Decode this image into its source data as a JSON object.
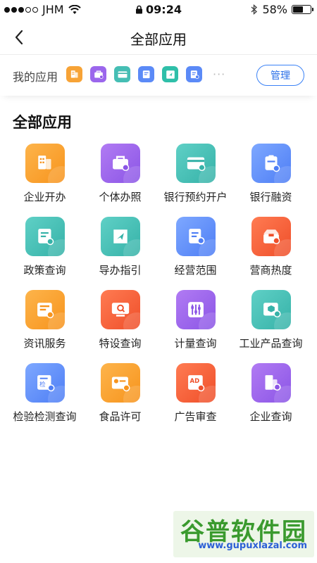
{
  "status_bar": {
    "carrier": "JHM",
    "time": "09:24",
    "battery": "58%",
    "battery_level": 0.58
  },
  "nav": {
    "title": "全部应用"
  },
  "my_apps": {
    "label": "我的应用",
    "icons": [
      {
        "icon": "building-icon",
        "color": "#f7a336"
      },
      {
        "icon": "briefcase-icon",
        "color": "#9b66ec"
      },
      {
        "icon": "card-icon",
        "color": "#45beb4"
      },
      {
        "icon": "document-icon",
        "color": "#5b8af7"
      },
      {
        "icon": "guide-icon",
        "color": "#2fbfa9"
      },
      {
        "icon": "document-search-icon",
        "color": "#5b8af7"
      }
    ],
    "more": "···",
    "manage_label": "管理"
  },
  "all_apps": {
    "title": "全部应用",
    "items": [
      {
        "label": "企业开办",
        "icon": "building-icon",
        "color": "orange"
      },
      {
        "label": "个体办照",
        "icon": "briefcase-icon",
        "color": "purple"
      },
      {
        "label": "银行预约开户",
        "icon": "bank-card-icon",
        "color": "teal"
      },
      {
        "label": "银行融资",
        "icon": "clipboard-yen-icon",
        "color": "blue"
      },
      {
        "label": "政策查询",
        "icon": "certificate-icon",
        "color": "teal"
      },
      {
        "label": "导办指引",
        "icon": "guide-book-icon",
        "color": "teal"
      },
      {
        "label": "经营范围",
        "icon": "document-search-icon",
        "color": "blue"
      },
      {
        "label": "营商热度",
        "icon": "box-fire-icon",
        "color": "red"
      },
      {
        "label": "资讯服务",
        "icon": "news-icon",
        "color": "orange"
      },
      {
        "label": "特设查询",
        "icon": "monitor-search-icon",
        "color": "red"
      },
      {
        "label": "计量查询",
        "icon": "sliders-icon",
        "color": "purple"
      },
      {
        "label": "工业产品查询",
        "icon": "product-search-icon",
        "color": "teal"
      },
      {
        "label": "检验检测查询",
        "icon": "inspection-icon",
        "color": "blue"
      },
      {
        "label": "食品许可",
        "icon": "food-license-icon",
        "color": "orange"
      },
      {
        "label": "广告审查",
        "icon": "ad-review-icon",
        "color": "red"
      },
      {
        "label": "企业查询",
        "icon": "building-search-icon",
        "color": "purple"
      }
    ]
  },
  "watermark": {
    "title": "谷普软件园",
    "url": "www.gupuxlazal.com"
  }
}
